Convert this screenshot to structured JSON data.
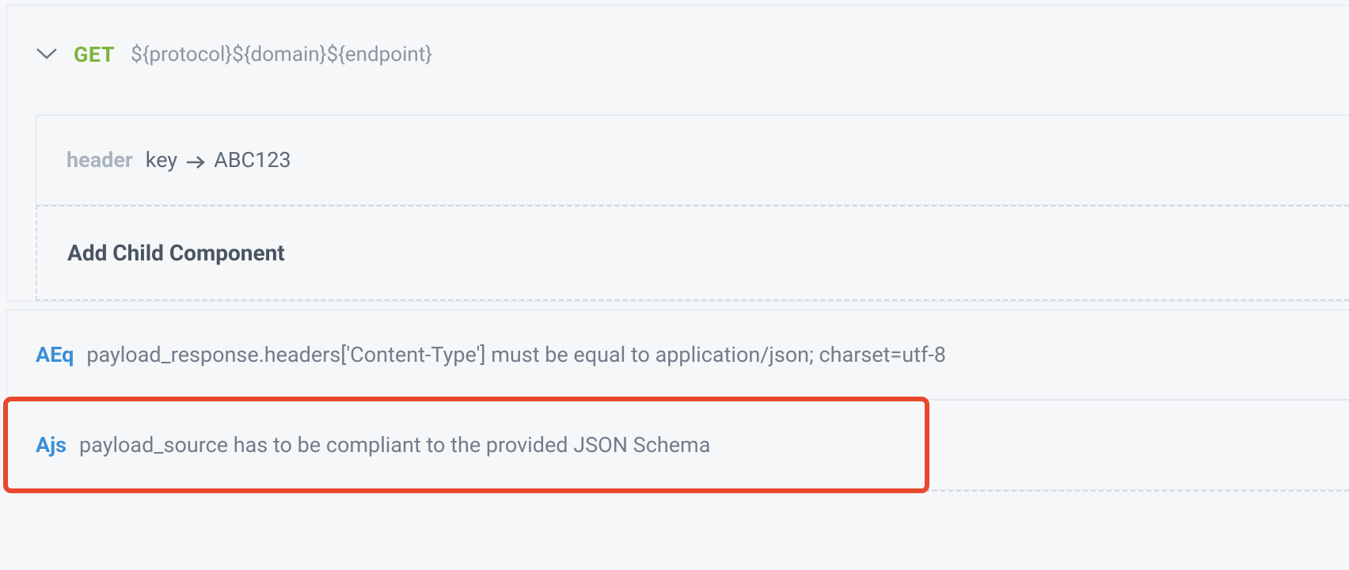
{
  "request": {
    "method": "GET",
    "url": "${protocol}${domain}${endpoint}"
  },
  "header": {
    "label": "header",
    "key": "key",
    "value": "ABC123"
  },
  "addChild": {
    "label": "Add Child Component"
  },
  "assertions": [
    {
      "tag": "AEq",
      "text": "payload_response.headers['Content-Type'] must be equal to application/json; charset=utf-8"
    },
    {
      "tag": "Ajs",
      "text": "payload_source has to be compliant to the provided JSON Schema"
    }
  ]
}
